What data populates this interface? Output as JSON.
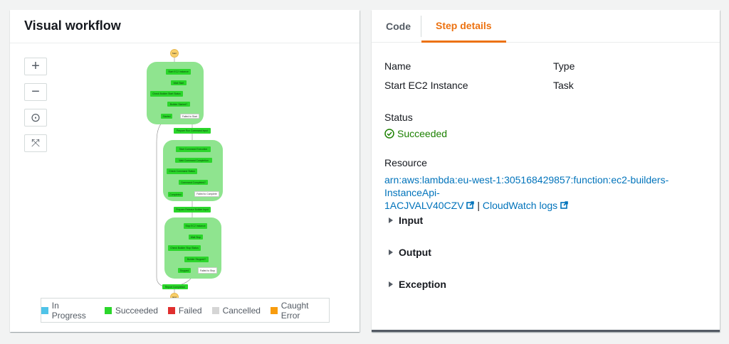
{
  "left_panel": {
    "title": "Visual workflow",
    "zoom_in": "+",
    "zoom_out": "−",
    "center": "⊙",
    "fit": "⤧"
  },
  "workflow": {
    "start": "Start",
    "end": "End",
    "g1": [
      "Start EC2 Instance",
      "Wait Start",
      "Check Builder Start Status",
      "Builder Started?",
      "Started",
      "Failed to Start"
    ],
    "prep1": "Prepare Run Command Input",
    "g2": [
      "Start Command Execution",
      "Wait Command Completion",
      "Check Command Status",
      "Command Completed?",
      "Completed",
      "Failed to Complete"
    ],
    "prep2": "Prepare Release Builder Input",
    "g3": [
      "Stop EC2 Instance",
      "Wait Stop",
      "Check Builder Stop Status",
      "Builder Stopped?",
      "Stopped",
      "Failed to Stop"
    ],
    "report": "Report Completion"
  },
  "legend": [
    {
      "label": "In Progress",
      "color": "#4fc3e8"
    },
    {
      "label": "Succeeded",
      "color": "#2bd62b"
    },
    {
      "label": "Failed",
      "color": "#e02f2f"
    },
    {
      "label": "Cancelled",
      "color": "#d5d5d5"
    },
    {
      "label": "Caught Error",
      "color": "#f89c0e"
    }
  ],
  "right_panel": {
    "tabs": [
      {
        "label": "Code"
      },
      {
        "label": "Step details",
        "active": true
      }
    ],
    "name_label": "Name",
    "name_value": "Start EC2 Instance",
    "type_label": "Type",
    "type_value": "Task",
    "status_label": "Status",
    "status_value": "Succeeded",
    "resource_label": "Resource",
    "resource_arn_1": "arn:aws:lambda:eu-west-1:305168429857:function:ec2-builders-InstanceApi-",
    "resource_arn_2": "1ACJVALV40CZV",
    "separator": "|",
    "cloudwatch": "CloudWatch logs",
    "sections": [
      "Input",
      "Output",
      "Exception"
    ]
  }
}
